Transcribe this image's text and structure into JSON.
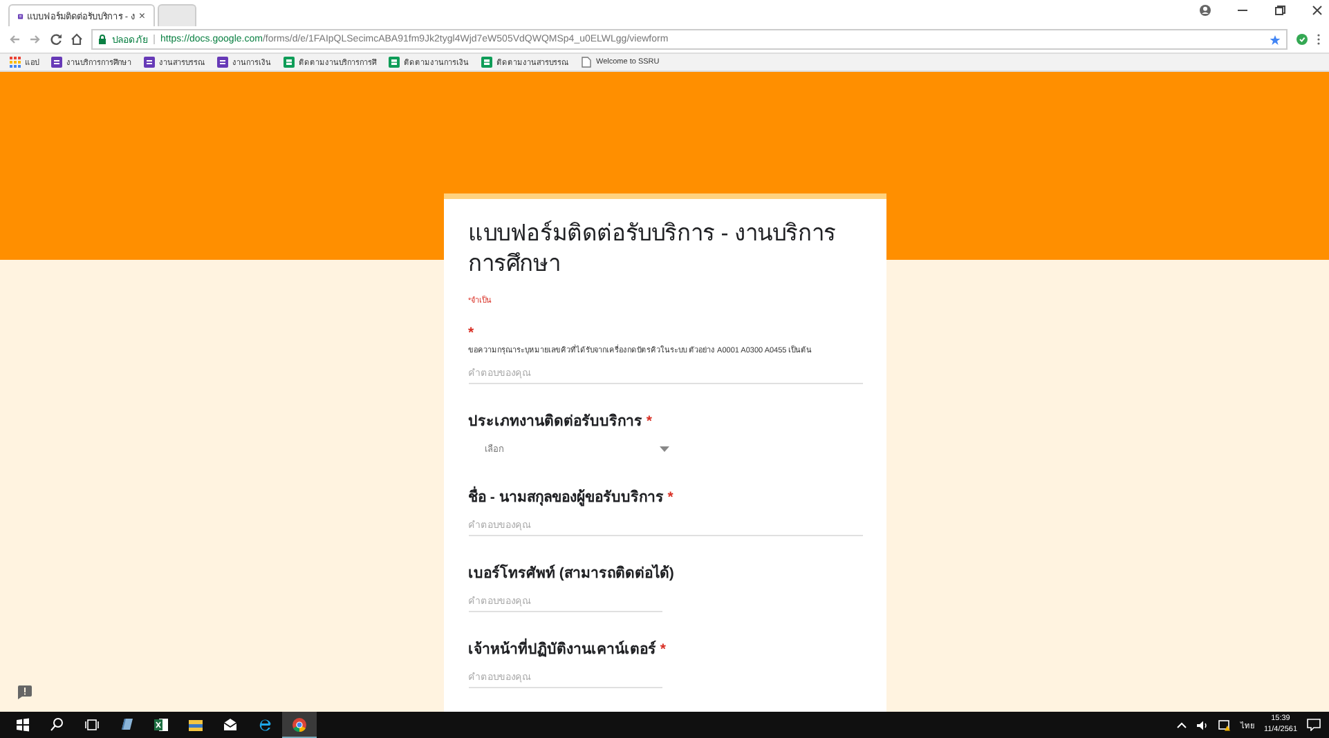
{
  "browser": {
    "tabs": [
      {
        "title": "แบบฟอร์มติดต่อรับบริการ - ง",
        "close": "×",
        "selected": true
      },
      {
        "selected": false
      }
    ],
    "secure_label": "ปลอดภัย",
    "url_host": "https://docs.google.com",
    "url_path": "/forms/d/e/1FAIpQLSecimcABA91fm9Jk2tygl4Wjd7eW505VdQWQMSp4_u0ELWLgg/viewform",
    "bookmarks": [
      {
        "label": "แอป",
        "kind": "apps"
      },
      {
        "label": "งานบริการการศึกษา",
        "kind": "form"
      },
      {
        "label": "งานสารบรรณ",
        "kind": "form"
      },
      {
        "label": "งานการเงิน",
        "kind": "form"
      },
      {
        "label": "ติดตามงานบริการการศึ",
        "kind": "sheet"
      },
      {
        "label": "ติดตามงานการเงิน",
        "kind": "sheet"
      },
      {
        "label": "ติดตามงานสารบรรณ",
        "kind": "sheet"
      },
      {
        "label": "Welcome to SSRU",
        "kind": "page"
      }
    ]
  },
  "form": {
    "title": "แบบฟอร์มติดต่อรับบริการ - งานบริการการศึกษา",
    "required_note": "*จำเป็น",
    "questions": [
      {
        "kind": "text",
        "required_mark": "*",
        "description": "ขอความกรุณาระบุหมายเลขคิวที่ได้รับจากเครื่องกดบัตรคิวในระบบ ตัวอย่าง A0001 A0300 A0455 เป็นต้น",
        "placeholder": "คำตอบของคุณ",
        "wide": true
      },
      {
        "kind": "dropdown",
        "title": "ประเภทงานติดต่อรับบริการ",
        "required_mark": "*",
        "placeholder": "เลือก"
      },
      {
        "kind": "text",
        "title": "ชื่อ - นามสกุลของผู้ขอรับบริการ",
        "required_mark": "*",
        "placeholder": "คำตอบของคุณ",
        "wide": true
      },
      {
        "kind": "text",
        "title": "เบอร์โทรศัพท์ (สามารถติดต่อได้)",
        "placeholder": "คำตอบของคุณ",
        "wide": false
      },
      {
        "kind": "text",
        "title": "เจ้าหน้าที่ปฏิบัติงานเคาน์เตอร์",
        "required_mark": "*",
        "placeholder": "คำตอบของคุณ",
        "wide": false
      }
    ]
  },
  "taskbar": {
    "apps": [
      {
        "kind": "start"
      },
      {
        "kind": "search"
      },
      {
        "kind": "taskview"
      },
      {
        "kind": "notes"
      },
      {
        "kind": "excel"
      },
      {
        "kind": "explorer"
      },
      {
        "kind": "mail"
      },
      {
        "kind": "ie"
      },
      {
        "kind": "chrome",
        "selected": true
      }
    ],
    "language": "ไทย",
    "time": "15:39",
    "date": "11/4/2561"
  }
}
